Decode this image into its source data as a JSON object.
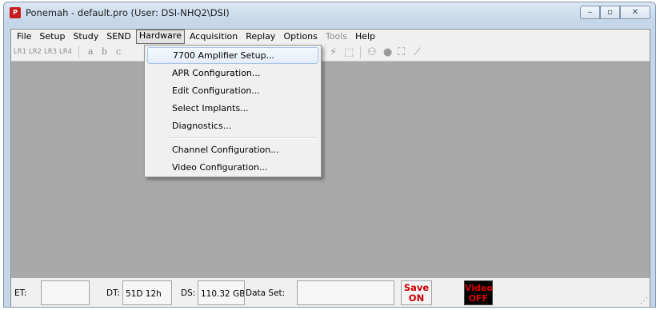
{
  "window": {
    "title": "Ponemah - default.pro (User: DSI-NHQ2\\DSI)",
    "app_icon_text": "P",
    "minimize_glyph": "‒",
    "maximize_glyph": "▫",
    "close_glyph": "✕"
  },
  "menubar": {
    "items": [
      "File",
      "Setup",
      "Study",
      "SEND",
      "Hardware",
      "Acquisition",
      "Replay",
      "Options",
      "Tools",
      "Help"
    ],
    "active": "Hardware",
    "disabled": [
      "Tools"
    ]
  },
  "toolbar": {
    "lr_buttons": [
      "LR1",
      "LR2",
      "LR3",
      "LR4"
    ],
    "letters": [
      "a",
      "b",
      "c"
    ],
    "icons": [
      "lightning-icon",
      "export-icon",
      "binoculars-icon",
      "record-icon",
      "marker-icon",
      "chart-icon"
    ],
    "icon_glyphs": [
      "⚡",
      "⬚",
      "⚇",
      "●",
      "⛶",
      "⟋"
    ]
  },
  "hardware_menu": {
    "items": [
      "7700 Amplifier Setup...",
      "APR Configuration...",
      "Edit Configuration...",
      "Select Implants...",
      "Diagnostics...",
      "Channel Configuration...",
      "Video Configuration..."
    ],
    "highlighted_index": 0
  },
  "statusbar": {
    "et_label": "ET:",
    "et_value": "",
    "dt_label": "DT:",
    "dt_value": "51D 12h",
    "ds_label": "DS:",
    "ds_value": "110.32 GB",
    "dataset_label": "Data Set:",
    "dataset_value": "",
    "save_line1": "Save",
    "save_line2": "ON",
    "video_line1": "Video",
    "video_line2": "OFF",
    "colors": {
      "save_text": "#cc0000",
      "video_bg": "#000000",
      "video_text": "#e00000"
    }
  }
}
